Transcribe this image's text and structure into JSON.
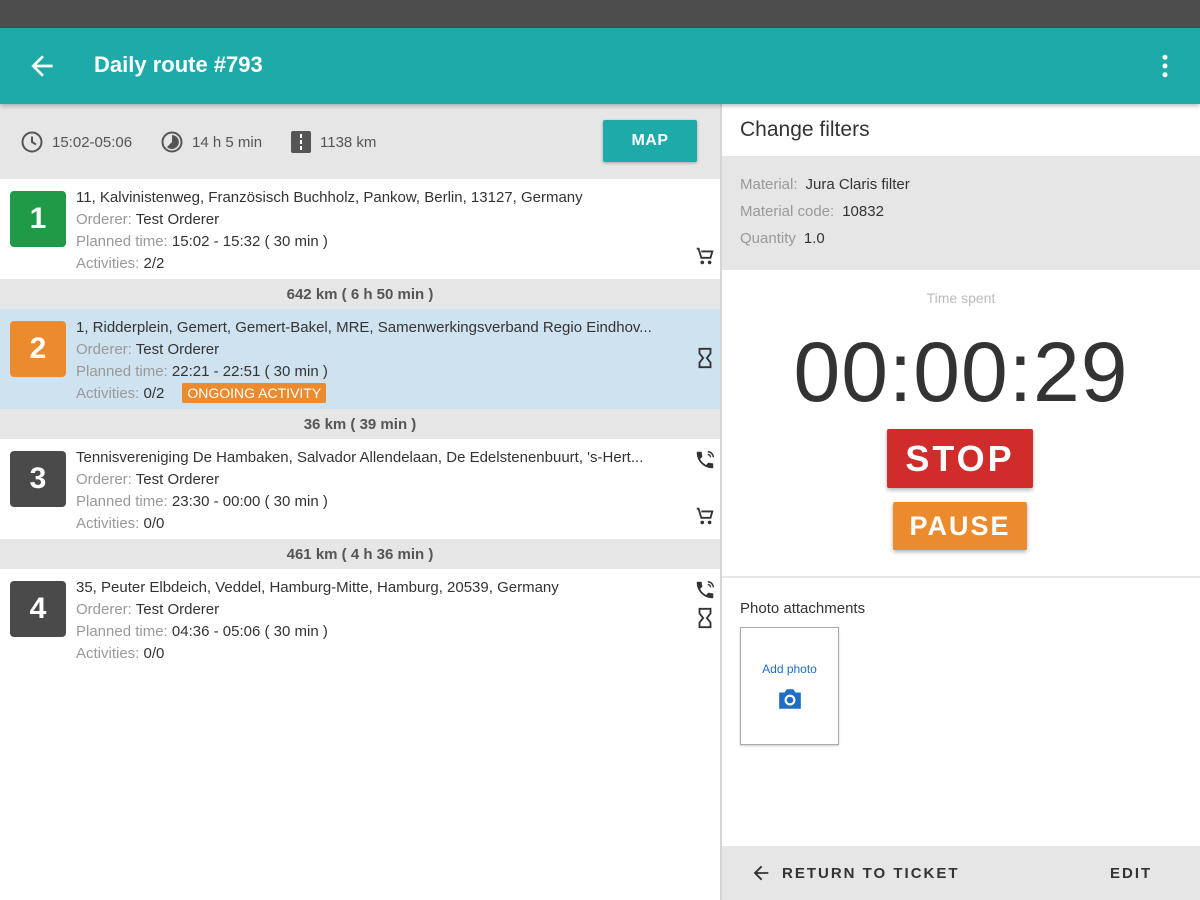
{
  "appbar": {
    "title": "Daily route #793"
  },
  "summary": {
    "time_range": "15:02-05:06",
    "duration": "14 h 5 min",
    "distance": "1138 km",
    "map_label": "MAP"
  },
  "labels": {
    "orderer": "Orderer:",
    "planned_time": "Planned time:",
    "activities": "Activities:"
  },
  "stops": [
    {
      "number": "1",
      "color": "#219a47",
      "address": "11, Kalvinistenweg, Französisch Buchholz, Pankow, Berlin, 13127, Germany",
      "orderer": "Test Orderer",
      "planned_time": "15:02 - 15:32 ( 30 min )",
      "activities": "2/2"
    },
    {
      "number": "2",
      "color": "#ec8b2d",
      "address": "1, Ridderplein, Gemert, Gemert-Bakel, MRE, Samenwerkingsverband Regio Eindhov...",
      "orderer": "Test Orderer",
      "planned_time": "22:21 - 22:51 ( 30 min )",
      "activities": "0/2",
      "status": "ONGOING ACTIVITY"
    },
    {
      "number": "3",
      "color": "#4a4a4a",
      "address": "Tennisvereniging De Hambaken, Salvador Allendelaan, De Edelstenenbuurt, 's-Hert...",
      "orderer": "Test Orderer",
      "planned_time": "23:30 - 00:00 ( 30 min )",
      "activities": "0/0"
    },
    {
      "number": "4",
      "color": "#4a4a4a",
      "address": "35, Peuter Elbdeich, Veddel, Hamburg-Mitte, Hamburg, 20539, Germany",
      "orderer": "Test Orderer",
      "planned_time": "04:36 - 05:06 ( 30 min )",
      "activities": "0/0"
    }
  ],
  "separators": [
    "642 km ( 6 h 50 min )",
    "36 km ( 39 min )",
    "461 km ( 4 h 36 min )"
  ],
  "panel": {
    "title": "Change filters",
    "material_label": "Material:",
    "material": "Jura Claris filter",
    "material_code_label": "Material code:",
    "material_code": "10832",
    "quantity_label": "Quantity",
    "quantity": "1.0",
    "time_spent_label": "Time spent",
    "timer": "00:00:29",
    "stop_label": "STOP",
    "pause_label": "PAUSE",
    "photo_title": "Photo attachments",
    "add_photo": "Add photo",
    "return_label": "RETURN TO TICKET",
    "edit_label": "EDIT"
  },
  "colors": {
    "primary": "#1eaaa8",
    "stop_red": "#d12c2c",
    "pause_orange": "#ec8b2d",
    "selected_row": "#cfe2f0"
  }
}
